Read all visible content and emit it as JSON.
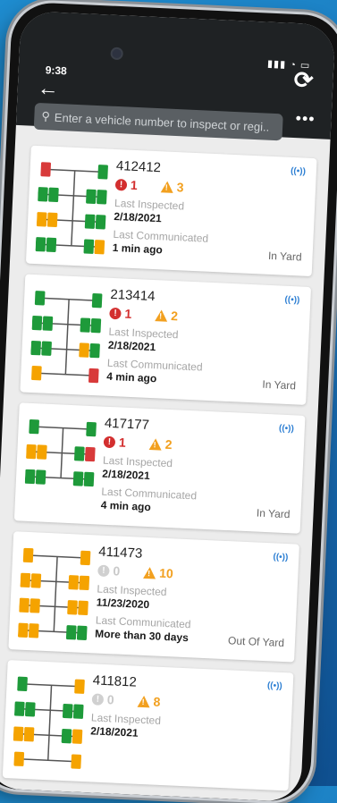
{
  "status_bar": {
    "time": "9:38",
    "signal_icons": "signal-wifi-battery"
  },
  "header": {
    "search_placeholder": "Enter a vehicle number to inspect or regi..."
  },
  "vehicles": [
    {
      "number": "412412",
      "errors": "1",
      "warnings": "3",
      "last_inspected_label": "Last Inspected",
      "last_inspected": "2/18/2021",
      "last_communicated_label": "Last Communicated",
      "last_communicated": "1 min ago",
      "yard_status": "In Yard",
      "comm_icon": "((•))",
      "tires": {
        "front": [
          "red",
          "green"
        ],
        "axle2": [
          "green",
          "green",
          "green",
          "green"
        ],
        "axle3": [
          "orange",
          "orange",
          "green",
          "green"
        ],
        "axle4": [
          "green",
          "green",
          "green",
          "orange"
        ]
      }
    },
    {
      "number": "213414",
      "errors": "1",
      "warnings": "2",
      "last_inspected_label": "Last Inspected",
      "last_inspected": "2/18/2021",
      "last_communicated_label": "Last Communicated",
      "last_communicated": "4 min ago",
      "yard_status": "In Yard",
      "comm_icon": "((•))",
      "tires": {
        "front": [
          "green",
          "green"
        ],
        "axle2": [
          "green",
          "green",
          "green",
          "green"
        ],
        "axle3": [
          "green",
          "green",
          "orange",
          "green"
        ],
        "axle4": [
          "orange",
          "red"
        ]
      }
    },
    {
      "number": "417177",
      "errors": "1",
      "warnings": "2",
      "last_inspected_label": "Last Inspected",
      "last_inspected": "2/18/2021",
      "last_communicated_label": "Last Communicated",
      "last_communicated": "4 min ago",
      "yard_status": "In Yard",
      "comm_icon": "((•))",
      "tires": {
        "front": [
          "green",
          "green"
        ],
        "axle2": [
          "orange",
          "orange",
          "green",
          "red"
        ],
        "axle3": [
          "green",
          "green",
          "green",
          "green"
        ]
      }
    },
    {
      "number": "411473",
      "errors": "0",
      "warnings": "10",
      "last_inspected_label": "Last Inspected",
      "last_inspected": "11/23/2020",
      "last_communicated_label": "Last Communicated",
      "last_communicated": "More than 30 days",
      "yard_status": "Out Of Yard",
      "comm_icon": "((•))",
      "tires": {
        "front": [
          "orange",
          "orange"
        ],
        "axle2": [
          "orange",
          "orange",
          "orange",
          "orange"
        ],
        "axle3": [
          "orange",
          "orange",
          "orange",
          "orange"
        ],
        "axle4": [
          "orange",
          "orange",
          "green",
          "green"
        ]
      }
    },
    {
      "number": "411812",
      "errors": "0",
      "warnings": "8",
      "last_inspected_label": "Last Inspected",
      "last_inspected": "2/18/2021",
      "last_communicated_label": "",
      "last_communicated": "",
      "yard_status": "",
      "comm_icon": "((•))",
      "tires": {
        "front": [
          "green",
          "orange"
        ],
        "axle2": [
          "green",
          "green",
          "green",
          "green"
        ],
        "axle3": [
          "orange",
          "orange",
          "green",
          "orange"
        ],
        "axle4": [
          "orange",
          "orange"
        ]
      }
    }
  ],
  "colors": {
    "ok": "#1e9a3a",
    "warn": "#f5a300",
    "crit": "#d83a3a",
    "accent": "#2d7fd3"
  }
}
